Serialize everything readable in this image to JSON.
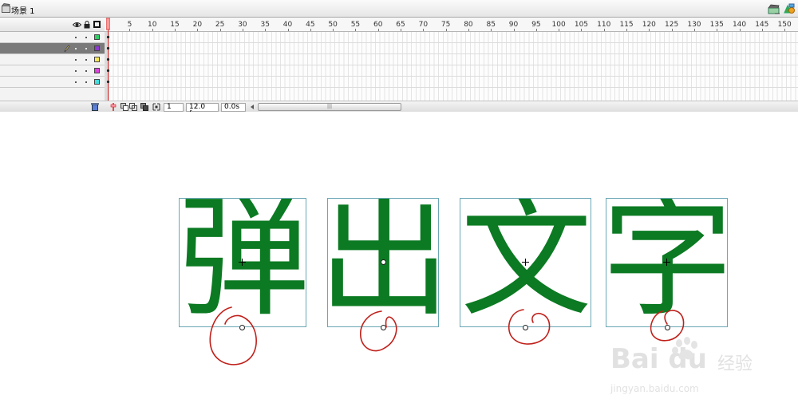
{
  "scene": {
    "label": "场景 1"
  },
  "timeline": {
    "ruler_labels": [
      "5",
      "10",
      "15",
      "20",
      "25",
      "30",
      "35",
      "40",
      "45",
      "50",
      "55",
      "60",
      "65",
      "70",
      "75",
      "80",
      "85",
      "90",
      "95",
      "100",
      "105",
      "110",
      "115",
      "120",
      "125",
      "130",
      "135",
      "140",
      "145",
      "150"
    ],
    "layer_swatch_colors": [
      "#33cc66",
      "#8d3ccf",
      "#f3e65a",
      "#dd44dd",
      "#44dddd"
    ],
    "active_layer_index": 1,
    "status": {
      "current_frame": "1",
      "frame_rate": "12.0 fps",
      "elapsed_time": "0.0s"
    },
    "scroll_grip": "|||"
  },
  "stage": {
    "glyph_color": "#0b7a22",
    "glyphs": [
      "弹",
      "出",
      "文",
      "字"
    ]
  },
  "annotation_color": "#c0201a",
  "watermark": {
    "brand": "Bai du",
    "cn": "经验",
    "url": "jingyan.baidu.com"
  }
}
